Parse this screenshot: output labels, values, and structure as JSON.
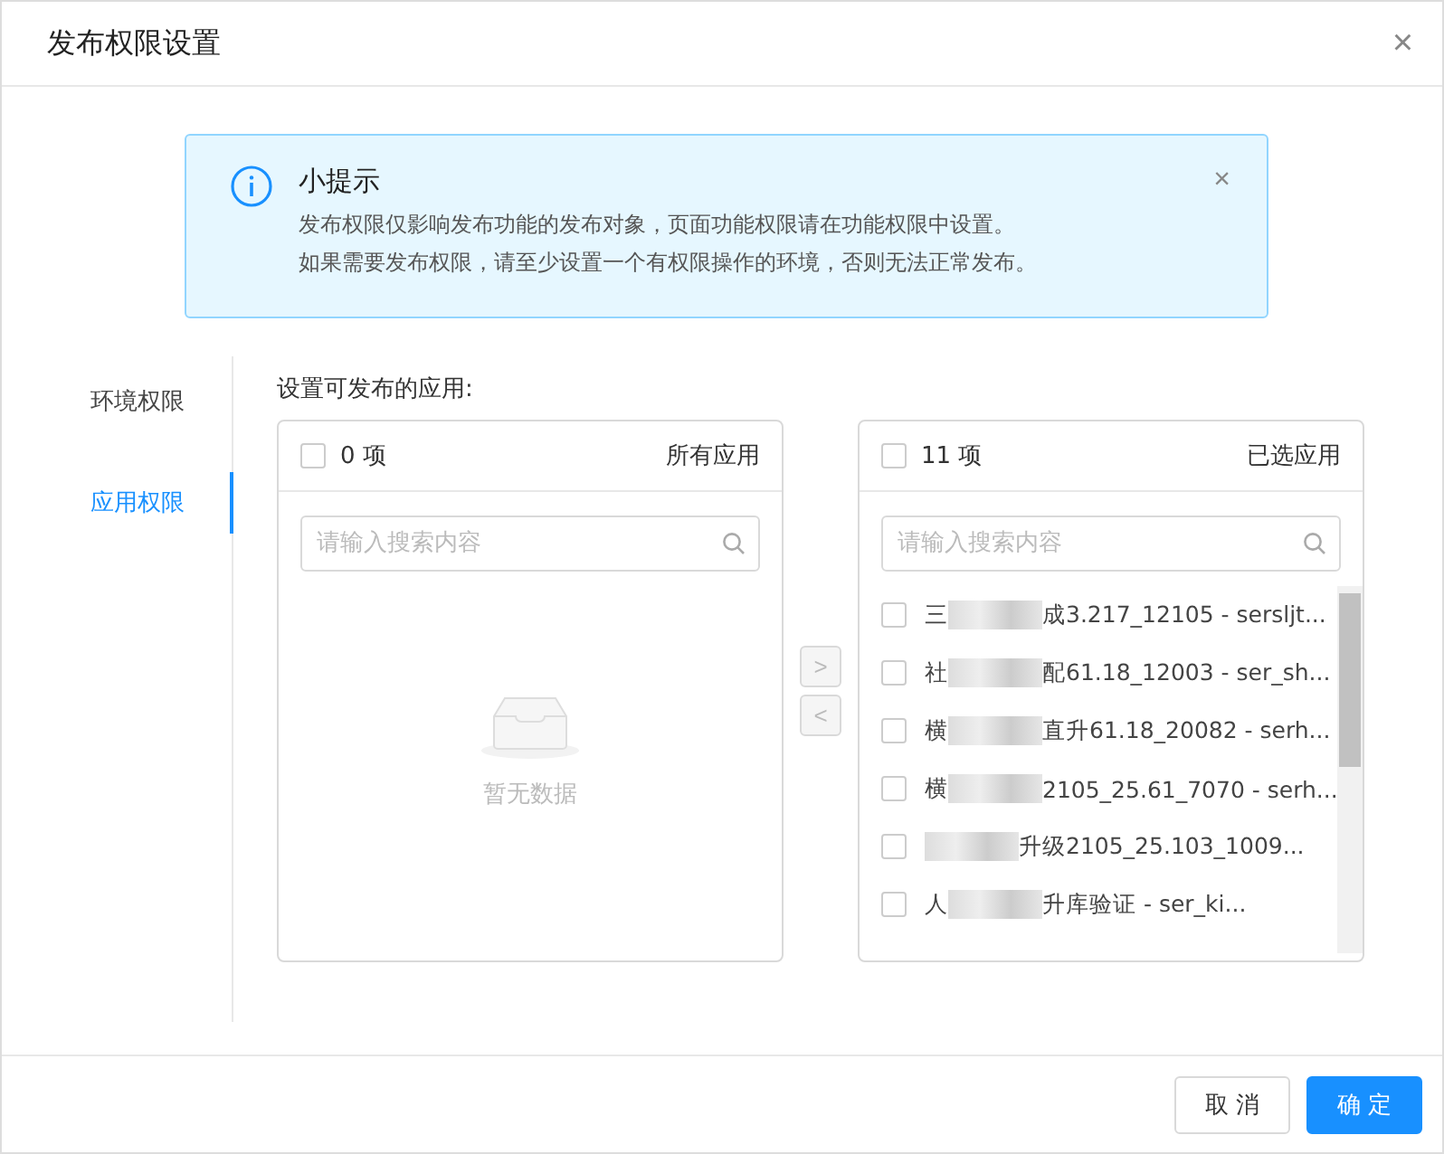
{
  "dialog": {
    "title": "发布权限设置",
    "close": "×"
  },
  "alert": {
    "title": "小提示",
    "lines": [
      "发布权限仅影响发布功能的发布对象，页面功能权限请在功能权限中设置。",
      "如果需要发布权限，请至少设置一个有权限操作的环境，否则无法正常发布。"
    ],
    "close": "×"
  },
  "tabs": [
    {
      "label": "环境权限",
      "selected": false
    },
    {
      "label": "应用权限",
      "selected": true
    }
  ],
  "section_label": "设置可发布的应用:",
  "source": {
    "count": "0 项",
    "title": "所有应用",
    "checked": false,
    "placeholder": "请输入搜索内容",
    "empty": "暂无数据"
  },
  "transfer_buttons": [
    {
      "label": ">",
      "disabled": true
    },
    {
      "label": "<",
      "disabled": true
    }
  ],
  "target": {
    "count": "11 项",
    "title": "已选应用",
    "checked": false,
    "placeholder": "请输入搜索内容",
    "items": [
      {
        "prefix": "三",
        "suffix": "成3.217_12105 - sersljt...",
        "checked": false
      },
      {
        "prefix": "社",
        "suffix": "配61.18_12003 - ser_sh...",
        "checked": false
      },
      {
        "prefix": "横",
        "suffix": "直升61.18_20082 - serh...",
        "checked": false
      },
      {
        "prefix": "横",
        "suffix": "2105_25.61_7070 - serh...",
        "checked": false
      },
      {
        "suffix": "升级2105_25.103_1009...",
        "checked": false
      },
      {
        "prefix": "人",
        "suffix": "升库验证 - ser_ki...",
        "checked": false
      }
    ]
  },
  "footer": {
    "buttons": [
      {
        "label": "取 消",
        "kind": "default"
      },
      {
        "label": "确 定",
        "kind": "primary"
      }
    ]
  }
}
